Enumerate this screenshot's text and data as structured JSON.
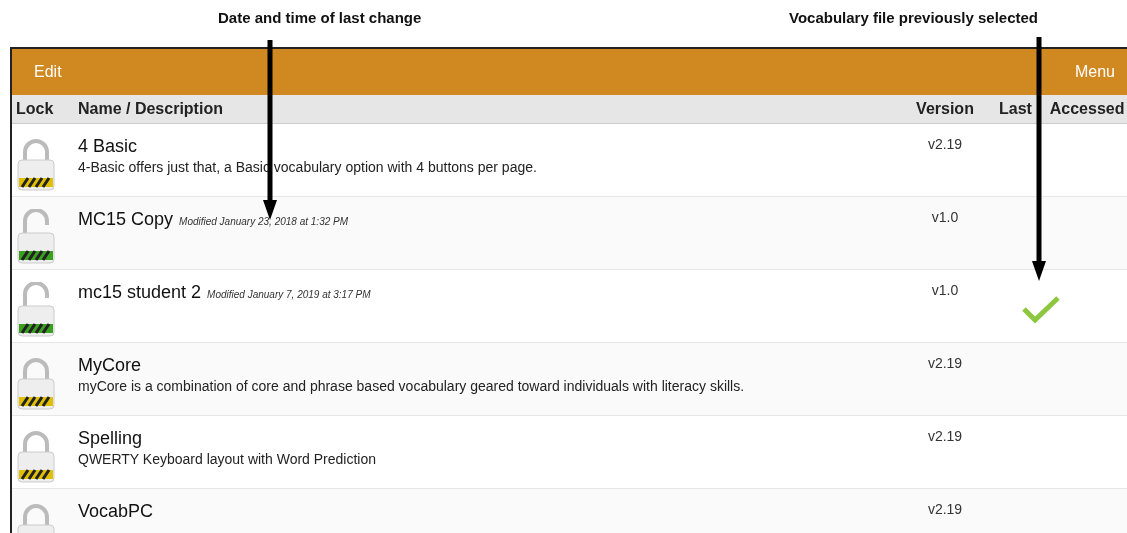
{
  "annotations": [
    {
      "text": "Date and time of last change"
    },
    {
      "text": "Vocabulary file previously selected"
    }
  ],
  "nav_bar": {
    "left_button": "Edit",
    "right_button": "Menu"
  },
  "table": {
    "columns": [
      "Lock",
      "Name / Description",
      "Version",
      "Last Accessed"
    ],
    "rows": [
      {
        "locked": true,
        "name": "4 Basic",
        "modified": "",
        "description": "4-Basic offers just that, a Basic vocabulary option with 4 buttons per page.",
        "version": "v2.19",
        "last_accessed": false
      },
      {
        "locked": false,
        "name": "MC15 Copy",
        "modified": "Modified January 23, 2018 at 1:32 PM",
        "description": "",
        "version": "v1.0",
        "last_accessed": false
      },
      {
        "locked": false,
        "name": "mc15 student 2",
        "modified": "Modified January 7, 2019 at 3:17 PM",
        "description": "",
        "version": "v1.0",
        "last_accessed": true
      },
      {
        "locked": true,
        "name": "MyCore",
        "modified": "",
        "description": "myCore is a combination of core and phrase based vocabulary geared toward individuals with literacy skills.",
        "version": "v2.19",
        "last_accessed": false
      },
      {
        "locked": true,
        "name": "Spelling",
        "modified": "",
        "description": "QWERTY Keyboard layout with Word Prediction",
        "version": "v2.19",
        "last_accessed": false
      },
      {
        "locked": true,
        "name": "VocabPC",
        "modified": "",
        "description": "",
        "version": "v2.19",
        "last_accessed": false
      }
    ]
  }
}
